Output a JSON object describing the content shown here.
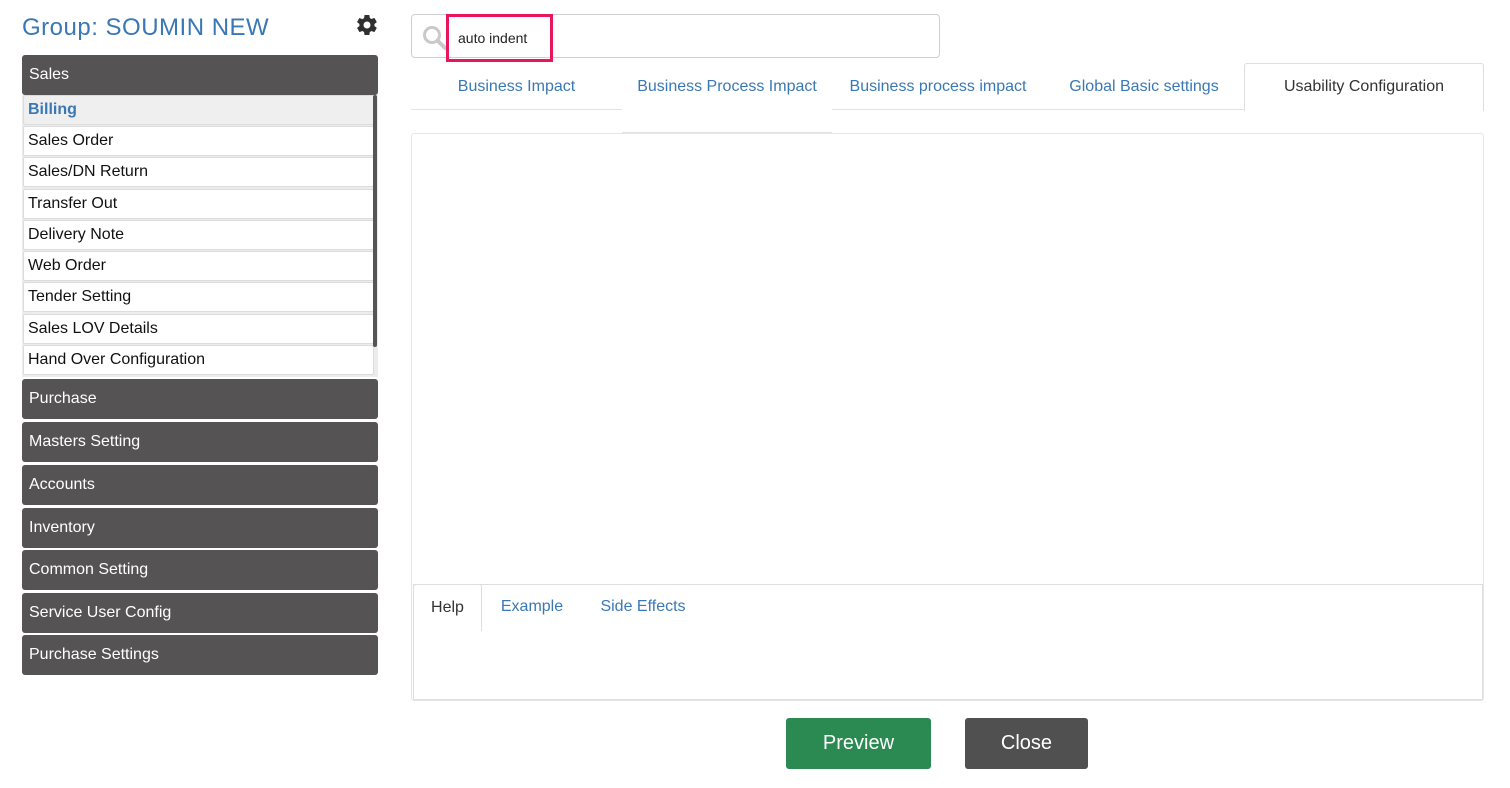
{
  "sidebar": {
    "group_title": "Group: SOUMIN NEW",
    "settings_icon": "gear-icon",
    "sections": [
      {
        "label": "Sales"
      },
      {
        "label": "Purchase"
      },
      {
        "label": "Masters Setting"
      },
      {
        "label": "Accounts"
      },
      {
        "label": "Inventory"
      },
      {
        "label": "Common Setting"
      },
      {
        "label": "Service User Config"
      },
      {
        "label": "Purchase Settings"
      }
    ],
    "sales_items": [
      {
        "label": "Billing",
        "active": true
      },
      {
        "label": "Sales Order"
      },
      {
        "label": "Sales/DN Return"
      },
      {
        "label": "Transfer Out"
      },
      {
        "label": "Delivery Note"
      },
      {
        "label": "Web Order"
      },
      {
        "label": "Tender Setting"
      },
      {
        "label": "Sales LOV Details"
      },
      {
        "label": "Hand Over Configuration"
      }
    ]
  },
  "search": {
    "icon": "search-icon",
    "value": "auto indent"
  },
  "tabs": [
    {
      "label": "Business Impact"
    },
    {
      "label": "Business Process Impact"
    },
    {
      "label": "Business process impact"
    },
    {
      "label": "Global Basic settings"
    },
    {
      "label": "Usability Configuration",
      "active": true
    }
  ],
  "help_tabs": [
    {
      "label": "Help",
      "active": true
    },
    {
      "label": "Example"
    },
    {
      "label": "Side Effects"
    }
  ],
  "buttons": {
    "preview": "Preview",
    "close": "Close"
  },
  "colors": {
    "accent_link": "#3a78b5",
    "section_header": "#555353",
    "preview_button": "#2a8a52",
    "close_button": "#505050",
    "search_highlight": "#e8175d"
  }
}
